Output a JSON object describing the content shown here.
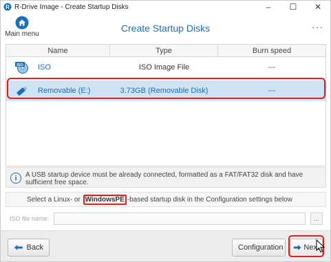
{
  "window": {
    "title": "R-Drive Image - Create Startup Disks",
    "controls": {
      "minimize": "–",
      "maximize": "☐",
      "close": "✕"
    }
  },
  "header": {
    "main_menu_label": "Main menu",
    "page_title": "Create Startup Disks",
    "more_label": "···"
  },
  "table": {
    "columns": [
      "Name",
      "Type",
      "Burn speed"
    ],
    "rows": [
      {
        "name": "ISO",
        "type": "ISO Image File",
        "burn_speed": "---",
        "icon": "iso-disc-icon"
      },
      {
        "name": "Removable (E:)",
        "type": "3.73GB (Removable Disk)",
        "burn_speed": "---",
        "icon": "usb-drive-icon",
        "selected": true
      }
    ]
  },
  "info": {
    "icon": "info-icon",
    "text": "A USB startup device must be already connected, formatted as a FAT/FAT32 disk and have sufficient free space."
  },
  "select_hint": {
    "before": "Select a Linux- or",
    "highlight": "WindowsPE",
    "after": "-based startup disk in the Configuration settings below"
  },
  "iso_file": {
    "label": "ISO file name:",
    "value": "",
    "browse_label": "..."
  },
  "footer": {
    "back_label": "Back",
    "configuration_label": "Configuration",
    "next_label": "Next"
  },
  "colors": {
    "accent": "#1a6fb5",
    "selection": "#cfe3f7",
    "highlight_box": "#e11d1d"
  }
}
